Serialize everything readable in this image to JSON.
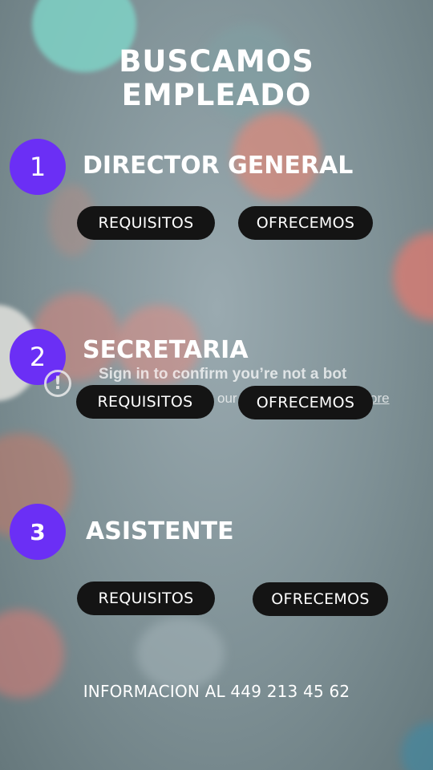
{
  "title": {
    "line1": "BUSCAMOS",
    "line2": "EMPLEADO"
  },
  "jobs": [
    {
      "number": "1",
      "name": "DIRECTOR GENERAL",
      "requirements_label": "REQUISITOS",
      "offer_label": "OFRECEMOS"
    },
    {
      "number": "2",
      "name": "SECRETARIA",
      "requirements_label": "REQUISITOS",
      "offer_label": "OFRECEMOS"
    },
    {
      "number": "3",
      "name": "ASISTENTE",
      "requirements_label": "REQUISITOS",
      "offer_label": "OFRECEMOS"
    }
  ],
  "bot_overlay": {
    "icon": "alert-circle-icon",
    "title": "Sign in to confirm you’re not a bot",
    "subtitle": "our",
    "link": "ore"
  },
  "footer": {
    "info": "INFORMACION AL 449 213 45 62"
  },
  "colors": {
    "badge": "#6b2ff5",
    "pill": "#141414",
    "text": "#ffffff"
  }
}
